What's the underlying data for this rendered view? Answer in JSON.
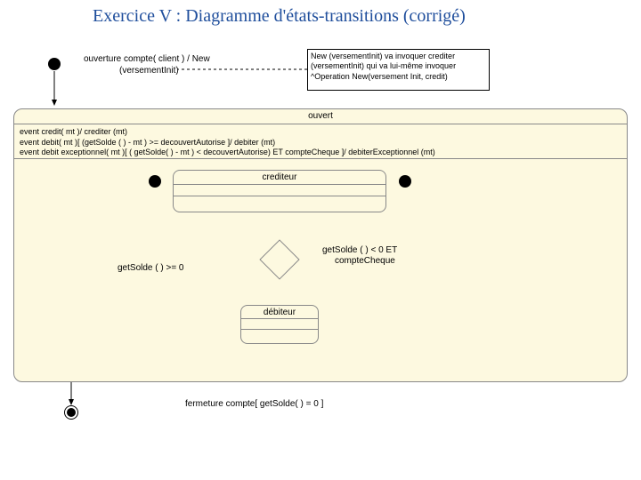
{
  "title": "Exercice V : Diagramme d'états-transitions (corrigé)",
  "topTransition": {
    "line1": "ouverture compte( client ) / New",
    "line2": "(versementInit)"
  },
  "note": {
    "line1": "New (versementInit) va invoquer crediter",
    "line2": "(versementInit) qui va lui-même invoquer",
    "line3": "^Operation New(versement Init, credit)"
  },
  "ouvert": {
    "title": "ouvert",
    "event1": "event credit( mt )/ crediter (mt)",
    "event2": "event debit( mt )[ (getSolde ( ) - mt ) >= decouvertAutorise ]/ debiter (mt)",
    "event3": "event debit exceptionnel( mt )[ ( getSolde( ) - mt ) < decouvertAutorise) ET compteCheque ]/ debiterExceptionnel (mt)"
  },
  "crediteur": "crediteur",
  "debiteur": "débiteur",
  "guardLeft": "getSolde ( ) >= 0",
  "guardRight": {
    "line1": "getSolde ( ) < 0 ET",
    "line2": "compteCheque"
  },
  "closeTransition": "fermeture compte[ getSolde( ) = 0 ]"
}
